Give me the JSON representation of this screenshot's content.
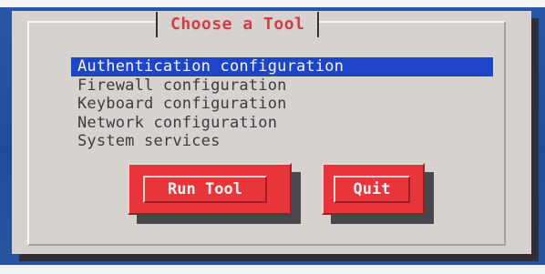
{
  "dialog": {
    "title": "Choose a Tool"
  },
  "menu": {
    "items": [
      {
        "label": "Authentication configuration",
        "selected": true
      },
      {
        "label": "Firewall configuration",
        "selected": false
      },
      {
        "label": "Keyboard configuration",
        "selected": false
      },
      {
        "label": "Network configuration",
        "selected": false
      },
      {
        "label": "System services",
        "selected": false
      }
    ]
  },
  "buttons": {
    "run_label": "Run Tool",
    "quit_label": "Quit"
  },
  "colors": {
    "background": "#2353a4",
    "dialog": "#d7d2cf",
    "title_text": "#d53b43",
    "selection": "#1e44c9",
    "button": "#e7353b",
    "shadow": "#2f2f35"
  }
}
